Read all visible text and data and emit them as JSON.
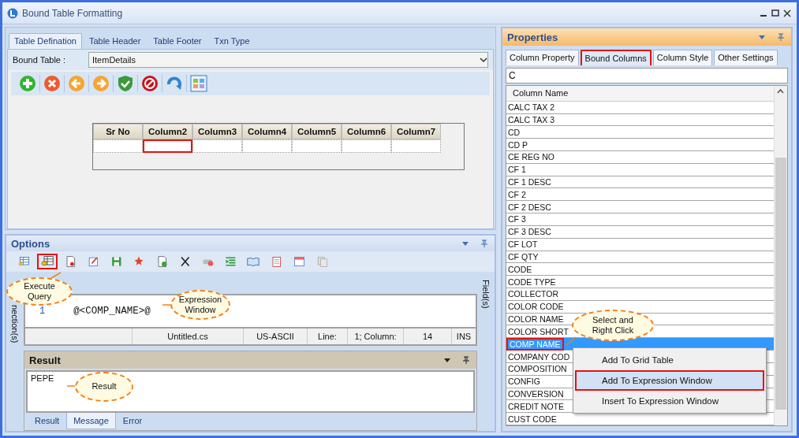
{
  "window": {
    "title": "Bound Table Formatting"
  },
  "left_tabs": [
    {
      "label": "Table Defination",
      "selected": true
    },
    {
      "label": "Table Header",
      "selected": false
    },
    {
      "label": "Table Footer",
      "selected": false
    },
    {
      "label": "Txn Type",
      "selected": false
    }
  ],
  "bound_table": {
    "label": "Bound Table :",
    "value": "ItemDetails"
  },
  "top_toolbar": [
    {
      "kind": "add"
    },
    {
      "kind": "delete"
    },
    {
      "kind": "back"
    },
    {
      "kind": "forward"
    },
    {
      "kind": "shield"
    },
    {
      "kind": "stop"
    },
    {
      "kind": "refresh"
    },
    {
      "kind": "layout"
    }
  ],
  "table": {
    "columns": [
      {
        "label": "Sr No",
        "highlighted": false
      },
      {
        "label": "Column2",
        "highlighted": true
      },
      {
        "label": "Column3",
        "highlighted": false
      },
      {
        "label": "Column4",
        "highlighted": false
      },
      {
        "label": "Column5",
        "highlighted": false
      },
      {
        "label": "Column6",
        "highlighted": false
      },
      {
        "label": "Column7",
        "highlighted": false
      }
    ]
  },
  "options": {
    "title": "Options",
    "toolbar": [
      {
        "kind": "table-menu",
        "highlighted": false
      },
      {
        "kind": "execute",
        "highlighted": true
      },
      {
        "kind": "doc-red",
        "highlighted": false
      },
      {
        "kind": "edit",
        "highlighted": false
      },
      {
        "kind": "save",
        "highlighted": false
      },
      {
        "kind": "spark",
        "highlighted": false
      },
      {
        "kind": "doc-check",
        "highlighted": false
      },
      {
        "kind": "cross",
        "highlighted": false
      },
      {
        "kind": "minus",
        "highlighted": false
      },
      {
        "kind": "indent",
        "highlighted": false
      },
      {
        "kind": "book",
        "highlighted": false
      },
      {
        "kind": "notepad",
        "highlighted": false
      },
      {
        "kind": "calendar",
        "highlighted": false
      },
      {
        "kind": "copy",
        "highlighted": false
      }
    ],
    "left_strip": "nection(s)",
    "right_strip": "Field(s)",
    "line_number": "1",
    "code": "@<COMP_NAME>@",
    "status": [
      "Untitled.cs",
      "US-ASCII",
      "Line:",
      "1; Column:",
      "14",
      "INS"
    ]
  },
  "result": {
    "title": "Result",
    "text": "PEPE",
    "tabs": [
      {
        "label": "Result",
        "selected": false
      },
      {
        "label": "Message",
        "selected": true
      },
      {
        "label": "Error",
        "selected": false
      }
    ]
  },
  "properties": {
    "title": "Properties",
    "tabs": [
      {
        "label": "Column Property",
        "selected": false,
        "highlighted": false
      },
      {
        "label": "Bound Columns",
        "selected": true,
        "highlighted": true
      },
      {
        "label": "Column Style",
        "selected": false,
        "highlighted": false
      },
      {
        "label": "Other Settings",
        "selected": false,
        "highlighted": false
      }
    ],
    "filter": "C",
    "column_header": "Column Name",
    "rows": [
      {
        "text": "CALC  TAX  2",
        "selected": false
      },
      {
        "text": "CALC  TAX  3",
        "selected": false
      },
      {
        "text": "CD",
        "selected": false
      },
      {
        "text": "CD  P",
        "selected": false
      },
      {
        "text": "CE  REG  NO",
        "selected": false
      },
      {
        "text": "CF  1",
        "selected": false
      },
      {
        "text": "CF  1  DESC",
        "selected": false
      },
      {
        "text": "CF  2",
        "selected": false
      },
      {
        "text": "CF  2  DESC",
        "selected": false
      },
      {
        "text": "CF  3",
        "selected": false
      },
      {
        "text": "CF  3  DESC",
        "selected": false
      },
      {
        "text": "CF  LOT",
        "selected": false
      },
      {
        "text": "CF  QTY",
        "selected": false
      },
      {
        "text": "CODE",
        "selected": false
      },
      {
        "text": "CODE  TYPE",
        "selected": false
      },
      {
        "text": "COLLECTOR",
        "selected": false
      },
      {
        "text": "COLOR  CODE",
        "selected": false
      },
      {
        "text": "COLOR  NAME",
        "selected": false
      },
      {
        "text": "COLOR  SHORT",
        "selected": false
      },
      {
        "text": "COMP  NAME",
        "selected": true
      },
      {
        "text": "COMPANY  COD",
        "selected": false
      },
      {
        "text": "COMPOSITION",
        "selected": false
      },
      {
        "text": "CONFIG",
        "selected": false
      },
      {
        "text": "CONVERSION",
        "selected": false
      },
      {
        "text": "CREDIT  NOTE",
        "selected": false
      },
      {
        "text": "CUST  CODE",
        "selected": false
      }
    ]
  },
  "context_menu": [
    {
      "label": "Add To Grid Table",
      "highlighted": false
    },
    {
      "label": "Add To Expression Window",
      "highlighted": true
    },
    {
      "label": "Insert To Expression Window",
      "highlighted": false
    }
  ],
  "callouts": [
    {
      "text": "Execute Query"
    },
    {
      "text": "Expression Window"
    },
    {
      "text": "Result"
    },
    {
      "text": "Select and Right Click"
    }
  ]
}
